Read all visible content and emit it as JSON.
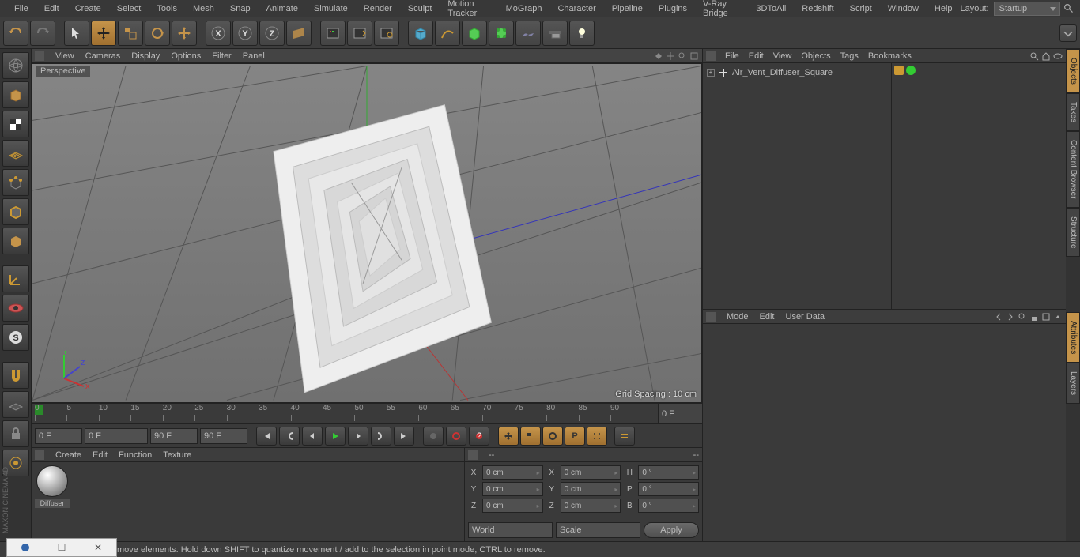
{
  "menubar": {
    "items": [
      "File",
      "Edit",
      "Create",
      "Select",
      "Tools",
      "Mesh",
      "Snap",
      "Animate",
      "Simulate",
      "Render",
      "Sculpt",
      "Motion Tracker",
      "MoGraph",
      "Character",
      "Pipeline",
      "Plugins",
      "V-Ray Bridge",
      "3DToAll",
      "Redshift",
      "Script",
      "Window",
      "Help"
    ],
    "layout_label": "Layout:",
    "layout_value": "Startup"
  },
  "viewport": {
    "menus": [
      "View",
      "Cameras",
      "Display",
      "Options",
      "Filter",
      "Panel"
    ],
    "label": "Perspective",
    "grid_info": "Grid Spacing : 10 cm"
  },
  "timeline": {
    "ticks": [
      "0",
      "5",
      "10",
      "15",
      "20",
      "25",
      "30",
      "35",
      "40",
      "45",
      "50",
      "55",
      "60",
      "65",
      "70",
      "75",
      "80",
      "85",
      "90"
    ],
    "end": "0 F",
    "start_field": "0 F",
    "range_from": "0 F",
    "range_to": "90 F",
    "cur": "90 F"
  },
  "materials": {
    "menus": [
      "Create",
      "Edit",
      "Function",
      "Texture"
    ],
    "items": [
      {
        "name": "Diffuser"
      }
    ]
  },
  "coords": {
    "header_left": "--",
    "header_right": "--",
    "x": "0 cm",
    "y": "0 cm",
    "z": "0 cm",
    "sx": "0 cm",
    "sy": "0 cm",
    "sz": "0 cm",
    "h": "0 °",
    "p": "0 °",
    "b": "0 °",
    "mode": "World",
    "space": "Scale",
    "apply": "Apply"
  },
  "objects": {
    "menus": [
      "File",
      "Edit",
      "View",
      "Objects",
      "Tags",
      "Bookmarks"
    ],
    "tree": [
      {
        "name": "Air_Vent_Diffuser_Square"
      }
    ]
  },
  "attributes": {
    "menus": [
      "Mode",
      "Edit",
      "User Data"
    ]
  },
  "right_tabs": [
    "Objects",
    "Takes",
    "Content Browser",
    "Structure"
  ],
  "right_tabs2": [
    "Attributes",
    "Layers"
  ],
  "status": "move elements. Hold down SHIFT to quantize movement / add to the selection in point mode, CTRL to remove.",
  "brand": "MAXON CINEMA 4D"
}
